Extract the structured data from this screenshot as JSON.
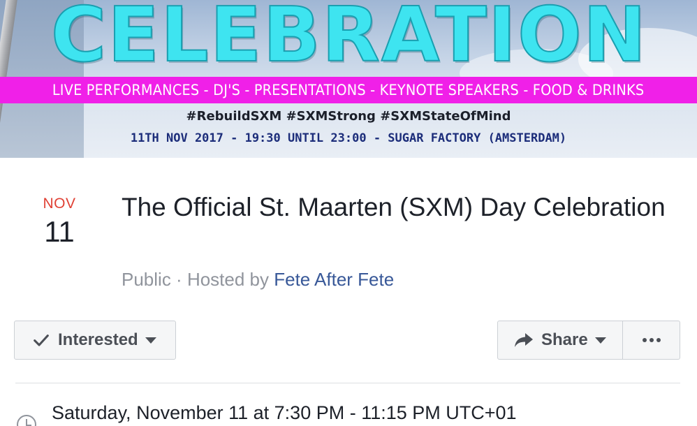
{
  "cover": {
    "title": "CELEBRATION",
    "strip_text": "LIVE PERFORMANCES - DJ'S - PRESENTATIONS - KEYNOTE SPEAKERS - FOOD & DRINKS",
    "hashtags": "#RebuildSXM #SXMStrong #SXMStateOfMind",
    "date_line": "11TH NOV 2017 - 19:30 UNTIL 23:00 - SUGAR FACTORY (AMSTERDAM)",
    "colors": {
      "title": "#3ee4f0",
      "strip": "#f020e8",
      "date_line": "#1c2d7a"
    }
  },
  "event": {
    "month": "NOV",
    "day": "11",
    "title": "The Official St. Maarten (SXM) Day Celebration",
    "privacy": "Public",
    "separator": " · ",
    "hosted_by_label": "Hosted by ",
    "host": "Fete After Fete"
  },
  "actions": {
    "interested_label": "Interested",
    "share_label": "Share",
    "icons": {
      "interested": "checkmark-icon",
      "share": "share-arrow-icon",
      "more": "more-dots-icon",
      "dropdown": "caret-down-icon"
    }
  },
  "details": {
    "time": "Saturday, November 11 at 7:30 PM - 11:15 PM UTC+01",
    "time_icon": "clock-icon"
  },
  "colors": {
    "month": "#e04135",
    "link": "#385898",
    "muted": "#90949c"
  }
}
